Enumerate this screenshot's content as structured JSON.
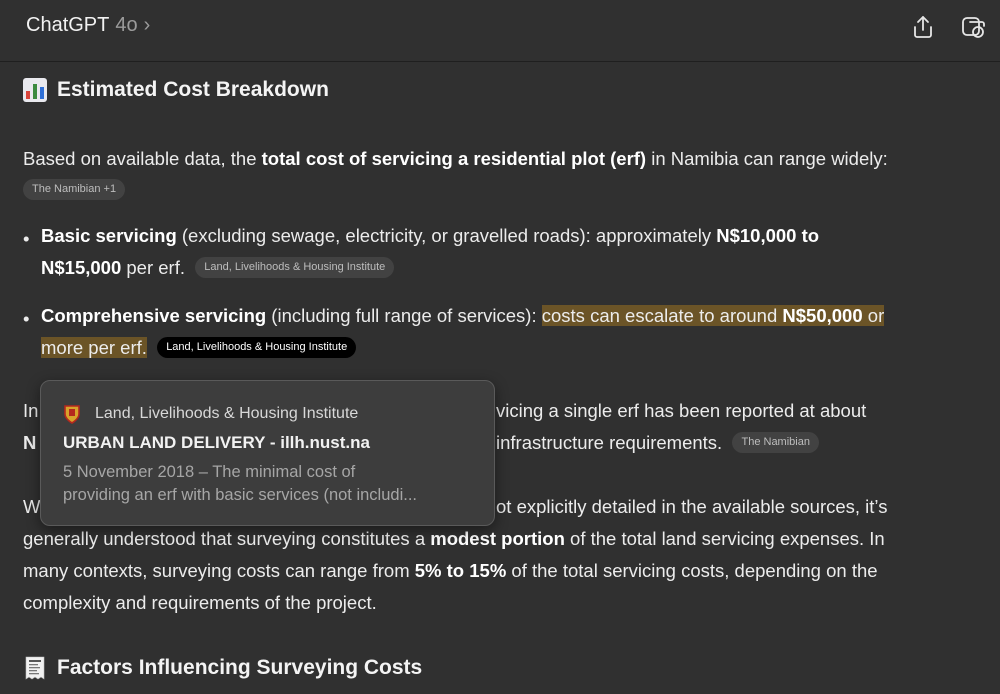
{
  "header": {
    "title": "ChatGPT",
    "model": "4o",
    "chevron": "›",
    "share_icon": "share-icon",
    "new_chat_icon": "new-chat-icon"
  },
  "section1": {
    "emoji": "bar-chart-icon",
    "heading": "Estimated Cost Breakdown"
  },
  "intro": {
    "pre": "Based on available data, the ",
    "bold": "total cost of servicing a residential plot (erf)",
    "post": " in Namibia can range widely:",
    "chip": "The Namibian +1"
  },
  "bullets": [
    {
      "bold": "Basic servicing",
      "text1": " (excluding sewage, electricity, or gravelled roads): approximately ",
      "bold2": "N$10,000 to",
      "bold3": "N$15,000",
      "text2": " per erf.",
      "chip": "Land, Livelihoods & Housing Institute"
    },
    {
      "bold": "Comprehensive servicing",
      "text1": " (including full range of services): ",
      "hl1": "costs can escalate to around ",
      "hl_bold": "N$50,000",
      "hl2": " or",
      "hl3": "more per erf.",
      "chip": "Land, Livelihoods & Housing Institute"
    }
  ],
  "para2": {
    "line1_start": "In",
    "line1_end": "vicing a single erf has been reported at about",
    "line2_start": "N",
    "line2_end": "infrastructure requirements.",
    "chip": "The Namibian"
  },
  "para3": {
    "line1_start": "W",
    "line1_end": "ot explicitly detailed in the available sources, it’s",
    "line2_pre": "generally understood that surveying constitutes a ",
    "line2_bold": "modest portion",
    "line2_post": " of the total land servicing expenses. In",
    "line3_pre": "many contexts, surveying costs can range from ",
    "line3_bold": "5% to 15%",
    "line3_post": " of the total servicing costs, depending on the",
    "line4": "complexity and requirements of the project."
  },
  "section2": {
    "emoji": "receipt-icon",
    "heading": "Factors Influencing Surveying Costs"
  },
  "tooltip": {
    "favicon": "institute-shield-icon",
    "source": "Land, Livelihoods & Housing Institute",
    "title": "URBAN LAND DELIVERY - illh.nust.na",
    "snippet_line1": "5 November 2018 – The minimal cost of",
    "snippet_line2": "providing an erf with basic services (not includi..."
  }
}
